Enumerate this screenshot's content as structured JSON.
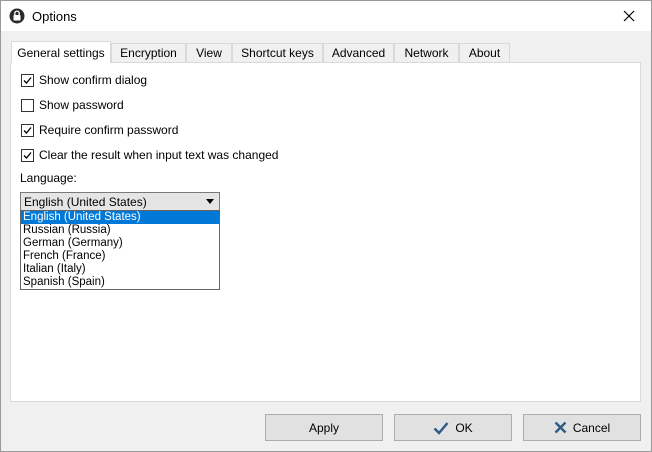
{
  "window": {
    "title": "Options"
  },
  "tabs": [
    {
      "label": "General settings",
      "active": true
    },
    {
      "label": "Encryption",
      "active": false
    },
    {
      "label": "View",
      "active": false
    },
    {
      "label": "Shortcut keys",
      "active": false
    },
    {
      "label": "Advanced",
      "active": false
    },
    {
      "label": "Network",
      "active": false
    },
    {
      "label": "About",
      "active": false
    }
  ],
  "general": {
    "options": [
      {
        "label": "Show confirm dialog",
        "checked": true
      },
      {
        "label": "Show password",
        "checked": false
      },
      {
        "label": "Require confirm password",
        "checked": true
      },
      {
        "label": "Clear the result when input text was changed",
        "checked": true
      }
    ],
    "language_label": "Language:",
    "language_selected": "English (United States)",
    "language_options": [
      "English (United States)",
      "Russian (Russia)",
      "German (Germany)",
      "French (France)",
      "Italian (Italy)",
      "Spanish (Spain)"
    ]
  },
  "buttons": {
    "apply": "Apply",
    "ok": "OK",
    "cancel": "Cancel"
  },
  "colors": {
    "selection": "#0078d7",
    "panel": "#ffffff",
    "chrome": "#f0f0f0"
  },
  "icons": {
    "app": "lock-icon",
    "close": "close-icon",
    "ok": "check-icon",
    "cancel": "x-icon",
    "combo": "chevron-down-icon"
  }
}
